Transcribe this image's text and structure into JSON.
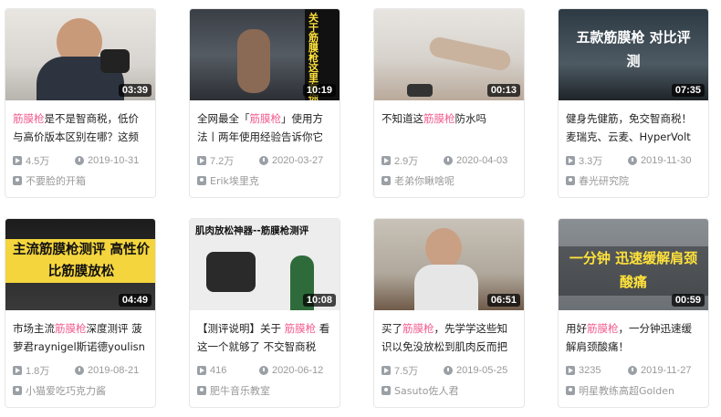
{
  "colors": {
    "highlight": "#f25d8e",
    "meta": "#999999",
    "duration_bg": "#000000"
  },
  "videos": [
    {
      "duration": "03:39",
      "title_pre": "",
      "title_hl": "筋膜枪",
      "title_post": "是不是智商税，低价与高价版本区别在哪？这频",
      "views": "4.5万",
      "date": "2019-10-31",
      "uploader": "不要脸的开箱",
      "thumb_text": ""
    },
    {
      "duration": "10:19",
      "title_pre": "全网最全「",
      "title_hl": "筋膜枪",
      "title_post": "」使用方法丨两年使用经验告诉你它",
      "views": "7.2万",
      "date": "2020-03-27",
      "uploader": "Erik埃里克",
      "thumb_text": "关于筋膜枪这里有你想知道的"
    },
    {
      "duration": "00:13",
      "title_pre": "不知道这",
      "title_hl": "筋膜枪",
      "title_post": "防水吗",
      "views": "2.9万",
      "date": "2020-04-03",
      "uploader": "老弟你瞅啥呢",
      "thumb_text": ""
    },
    {
      "duration": "07:35",
      "title_pre": "健身先健筋，免交智商税！麦瑞克、云麦、HyperVolt",
      "title_hl": "",
      "title_post": "",
      "views": "3.3万",
      "date": "2019-11-30",
      "uploader": "春光研究院",
      "thumb_text": "五款筋膜枪 对比评测"
    },
    {
      "duration": "04:49",
      "title_pre": "市场主流",
      "title_hl": "筋膜枪",
      "title_post": "深度测评 菠萝君raynigel斯诺德youlisn",
      "views": "1.8万",
      "date": "2019-08-21",
      "uploader": "小猫爱吃巧克力酱",
      "thumb_text": "主流筋膜枪测评 高性价比筋膜放松"
    },
    {
      "duration": "10:08",
      "title_pre": "【测评说明】关于 ",
      "title_hl": "筋膜枪",
      "title_post": " 看这一个就够了 不交智商税",
      "views": "416",
      "date": "2020-06-12",
      "uploader": "肥牛音乐教室",
      "thumb_text": "肌肉放松神器--筋膜枪测评"
    },
    {
      "duration": "06:51",
      "title_pre": "买了",
      "title_hl": "筋膜枪",
      "title_post": "，先学学这些知识以免没放松到肌肉反而把",
      "views": "7.5万",
      "date": "2019-05-25",
      "uploader": "Sasuto佐人君",
      "thumb_text": ""
    },
    {
      "duration": "00:59",
      "title_pre": "用好",
      "title_hl": "筋膜枪",
      "title_post": "，一分钟迅速缓解肩颈酸痛！",
      "views": "3235",
      "date": "2019-11-27",
      "uploader": "明星教练高超Golden",
      "thumb_text": "一分钟 迅速缓解肩颈酸痛"
    }
  ]
}
